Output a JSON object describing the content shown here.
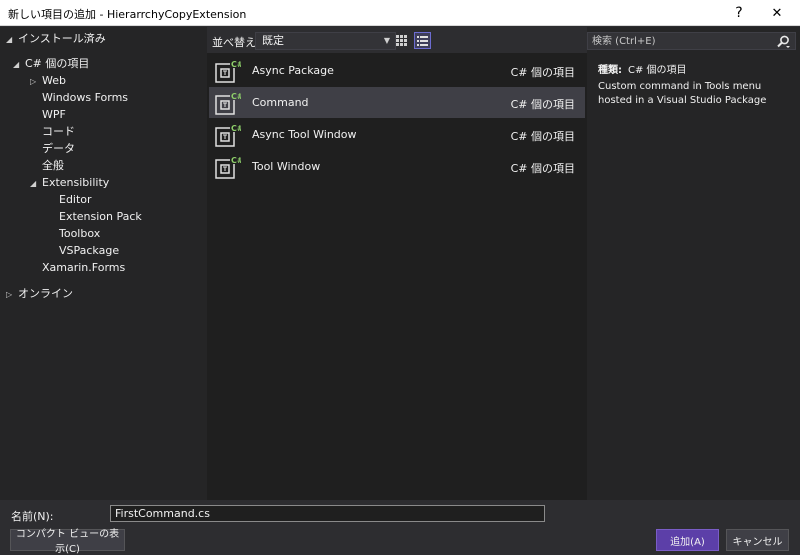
{
  "window": {
    "title": "新しい項目の追加 - HierarrchyCopyExtension",
    "help": "?",
    "close": "✕"
  },
  "tree": {
    "installed": "インストール済み",
    "csharp": "C# 個の項目",
    "web": "Web",
    "windows_forms": "Windows Forms",
    "wpf": "WPF",
    "code": "コード",
    "data": "データ",
    "general": "全般",
    "extensibility": "Extensibility",
    "editor": "Editor",
    "extension_pack": "Extension Pack",
    "toolbox": "Toolbox",
    "vspackage": "VSPackage",
    "xamarin_forms": "Xamarin.Forms",
    "online": "オンライン",
    "arrow_expanded": "◢",
    "arrow_collapsed": "▷"
  },
  "toolbar": {
    "sort_label": "並べ替え:",
    "sort_value": "既定",
    "sort_chevron": "▼"
  },
  "templates": [
    {
      "name": "Async Package",
      "lang": "C# 個の項目",
      "selected": false
    },
    {
      "name": "Command",
      "lang": "C# 個の項目",
      "selected": true
    },
    {
      "name": "Async Tool Window",
      "lang": "C# 個の項目",
      "selected": false
    },
    {
      "name": "Tool Window",
      "lang": "C# 個の項目",
      "selected": false
    }
  ],
  "details": {
    "search_placeholder": "検索 (Ctrl+E)",
    "kind_label": "種類:",
    "kind_value": "C# 個の項目",
    "description": "Custom command in Tools menu hosted in a Visual Studio Package"
  },
  "bottom": {
    "name_label": "名前(N):",
    "name_value": "FirstCommand.cs",
    "compact_button": "コンパクト ビューの表示(C)",
    "add_button": "追加(A)",
    "cancel_button": "キャンセル"
  },
  "colors": {
    "accent": "#5c3fa8",
    "selection": "#3f3f46",
    "icon_green": "#8ecf6a"
  }
}
